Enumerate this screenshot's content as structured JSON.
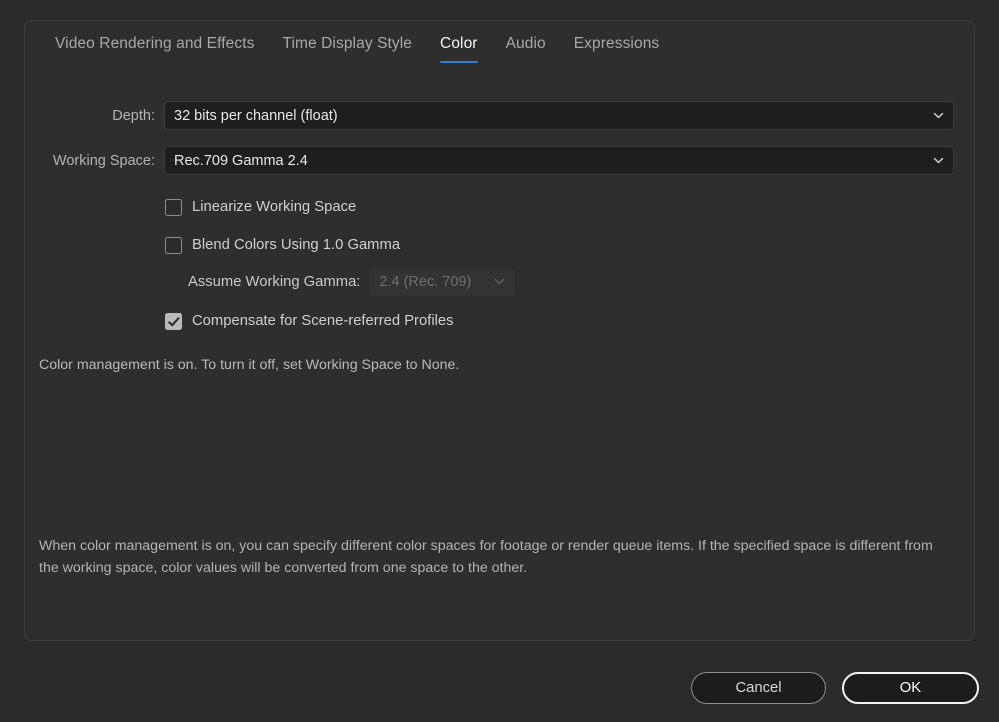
{
  "dialog": {
    "tabs": [
      {
        "label": "Video Rendering and Effects",
        "active": false
      },
      {
        "label": "Time Display Style",
        "active": false
      },
      {
        "label": "Color",
        "active": true
      },
      {
        "label": "Audio",
        "active": false
      },
      {
        "label": "Expressions",
        "active": false
      }
    ],
    "fields": {
      "depth": {
        "label": "Depth:",
        "value": "32 bits per channel (float)",
        "icon": "chevron-down-icon"
      },
      "working_space": {
        "label": "Working Space:",
        "value": "Rec.709 Gamma 2.4",
        "icon": "chevron-down-icon"
      },
      "assume_working_gamma": {
        "label": "Assume Working Gamma:",
        "value": "2.4 (Rec. 709)",
        "icon": "chevron-down-icon",
        "disabled": true
      }
    },
    "checkboxes": [
      {
        "label": "Linearize Working Space",
        "checked": false
      },
      {
        "label": "Blend Colors Using 1.0 Gamma",
        "checked": false
      },
      {
        "label": "Compensate for Scene-referred Profiles",
        "checked": true
      }
    ],
    "notes": {
      "status": "Color management is on. To turn it off, set Working Space to None.",
      "description": "When color management is on, you can specify different color spaces for footage or render queue items. If the specified space is different from the working space, color values will be converted from one space to the other."
    },
    "buttons": {
      "cancel": "Cancel",
      "ok": "OK"
    },
    "colors": {
      "accent": "#2f7fd4",
      "window_background": "#2b2b2b",
      "panel_background": "#2e2e2e",
      "field_background": "#1e1e1e",
      "text_primary": "#e8e8e8",
      "text_secondary": "#b4b4b4",
      "text_disabled": "#6f6f6f"
    }
  }
}
